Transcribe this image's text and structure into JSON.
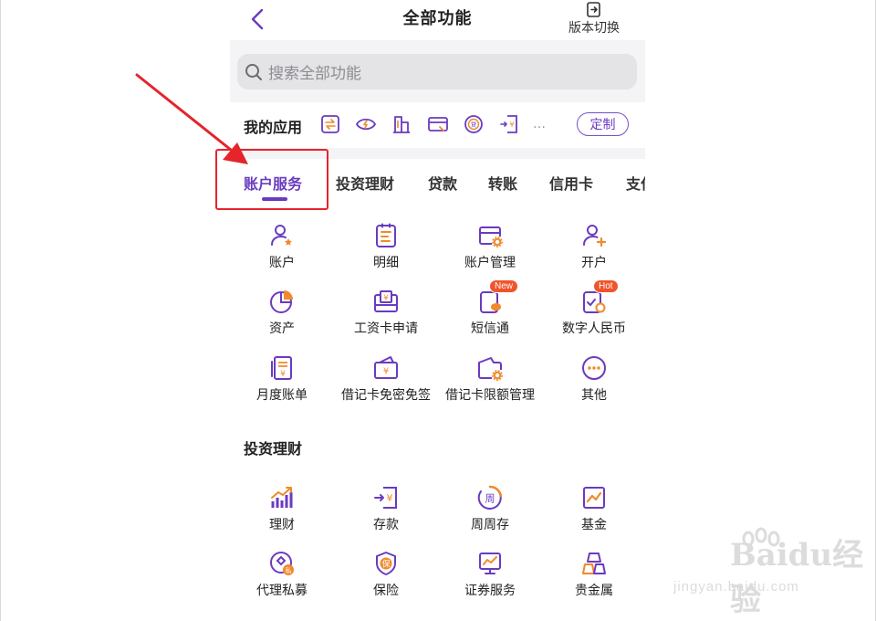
{
  "header": {
    "title": "全部功能",
    "version_switch_label": "版本切换"
  },
  "search": {
    "placeholder": "搜索全部功能"
  },
  "my_apps": {
    "label": "我的应用",
    "icons": [
      "transfer-icon",
      "eye-icon",
      "building-icon",
      "card-icon",
      "loan-icon",
      "deposit-icon"
    ],
    "more": "…",
    "customize_label": "定制"
  },
  "tabs": [
    "账户服务",
    "投资理财",
    "贷款",
    "转账",
    "信用卡",
    "支付"
  ],
  "account_services": [
    {
      "label": "账户",
      "icon": "user-star-icon"
    },
    {
      "label": "明细",
      "icon": "list-icon"
    },
    {
      "label": "账户管理",
      "icon": "card-gear-icon"
    },
    {
      "label": "开户",
      "icon": "user-plus-icon"
    },
    {
      "label": "资产",
      "icon": "pie-chart-icon"
    },
    {
      "label": "工资卡申请",
      "icon": "salary-card-icon"
    },
    {
      "label": "短信通",
      "icon": "sms-icon",
      "badge": "New"
    },
    {
      "label": "数字人民币",
      "icon": "digital-rmb-icon",
      "badge": "Hot"
    },
    {
      "label": "月度账单",
      "icon": "bill-icon"
    },
    {
      "label": "借记卡免密免签",
      "icon": "debit-card-icon"
    },
    {
      "label": "借记卡限额管理",
      "icon": "wallet-gear-icon"
    },
    {
      "label": "其他",
      "icon": "more-icon"
    }
  ],
  "investment_section": {
    "title": "投资理财",
    "items": [
      {
        "label": "理财",
        "icon": "growth-chart-icon"
      },
      {
        "label": "存款",
        "icon": "deposit-icon"
      },
      {
        "label": "周周存",
        "icon": "weekly-icon"
      },
      {
        "label": "基金",
        "icon": "fund-icon"
      },
      {
        "label": "代理私募",
        "icon": "private-fund-icon"
      },
      {
        "label": "保险",
        "icon": "shield-icon"
      },
      {
        "label": "证券服务",
        "icon": "monitor-chart-icon"
      },
      {
        "label": "贵金属",
        "icon": "gold-bars-icon"
      }
    ]
  },
  "watermark": {
    "brand": "Baidu经验",
    "url": "jingyan.baidu.com"
  },
  "colors": {
    "accent": "#6a3bbf",
    "orange": "#f08a2c",
    "annotation_red": "#e5242b"
  }
}
